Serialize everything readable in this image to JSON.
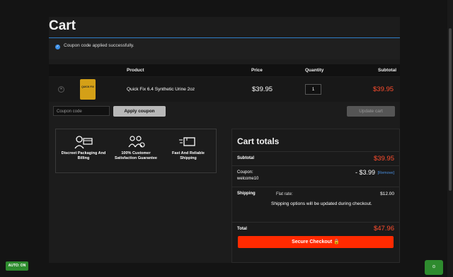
{
  "page": {
    "title": "Cart"
  },
  "notice": {
    "message": "Coupon code applied successfully."
  },
  "table": {
    "headers": {
      "product": "Product",
      "price": "Price",
      "quantity": "Quantity",
      "subtotal": "Subtotal"
    },
    "items": [
      {
        "name": "Quick Fix 6.4 Synthetic Urine 2oz",
        "price": "$39.95",
        "quantity": "1",
        "subtotal": "$39.95",
        "image_label": "QUICK FIX"
      }
    ]
  },
  "coupon": {
    "placeholder": "Coupon code",
    "apply_label": "Apply coupon",
    "update_label": "Update cart"
  },
  "features": [
    {
      "icon": "packaging-icon",
      "label": "Discreet Packaging And Billing"
    },
    {
      "icon": "customer-satisfaction-icon",
      "label": "100% Customer Satisfaction Guarantee"
    },
    {
      "icon": "shipping-icon",
      "label": "Fast And Reliable Shipping"
    }
  ],
  "totals": {
    "heading": "Cart totals",
    "subtotal_label": "Subtotal",
    "subtotal_value": "$39.95",
    "coupon_label": "Coupon:",
    "coupon_code": "welcome10",
    "coupon_value": "- $3.99",
    "coupon_remove": "[Remove]",
    "shipping_label": "Shipping",
    "flat_rate_label": "Flat rate:",
    "flat_rate_value": "$12.00",
    "shipping_note": "Shipping options will be updated during checkout.",
    "total_label": "Total",
    "total_value": "$47.96",
    "checkout_label": "Secure Checkout"
  },
  "widgets": {
    "auto_on": "AUTO: ON",
    "chat": "⊙"
  },
  "colors": {
    "accent_red": "#ff4d2e",
    "checkout_bg": "#ff2a00",
    "link_blue": "#4a90e2",
    "divider_blue": "#2f7ec8"
  }
}
